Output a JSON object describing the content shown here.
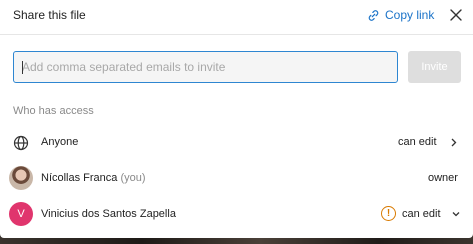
{
  "header": {
    "title": "Share this file",
    "copy_link_label": "Copy link",
    "copy_link_icon": "link-icon",
    "close_icon": "close-icon"
  },
  "invite": {
    "placeholder": "Add comma separated emails to invite",
    "value": "",
    "button_label": "Invite"
  },
  "access": {
    "section_label": "Who has access",
    "rows": [
      {
        "icon": "globe-icon",
        "name": "Anyone",
        "suffix": "",
        "role": "can edit",
        "control_icon": "chevron-right-icon"
      },
      {
        "icon": "avatar-photo",
        "name": "Nícollas Franca",
        "suffix": "(you)",
        "role": "owner",
        "control_icon": ""
      },
      {
        "icon": "avatar-letter",
        "avatar_letter": "V",
        "avatar_color": "#e0356d",
        "name": "Vinicius dos Santos Zapella",
        "suffix": "",
        "warning_icon": "warning-icon",
        "warning_glyph": "!",
        "role": "can edit",
        "control_icon": "chevron-down-icon"
      }
    ]
  },
  "colors": {
    "accent": "#1b73c8",
    "input_focus_border": "#2e86d1",
    "invite_disabled": "#dedede",
    "warning": "#d97a00"
  }
}
